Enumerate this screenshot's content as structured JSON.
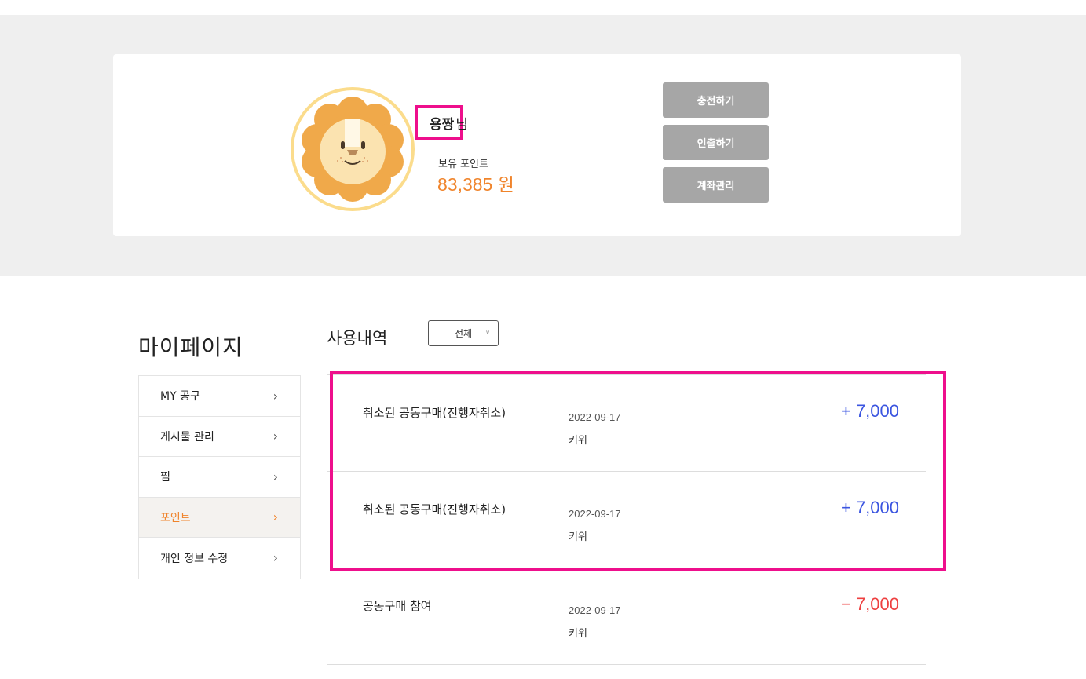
{
  "profile": {
    "user_name": "용짱",
    "honorific": "님",
    "points_label": "보유 포인트",
    "points_value": "83,385 원",
    "buttons": [
      "충전하기",
      "인출하기",
      "계좌관리"
    ]
  },
  "sidebar": {
    "title": "마이페이지",
    "items": [
      {
        "label": "MY 공구",
        "active": false
      },
      {
        "label": "게시물 관리",
        "active": false
      },
      {
        "label": "찜",
        "active": false
      },
      {
        "label": "포인트",
        "active": true
      },
      {
        "label": "개인 정보 수정",
        "active": false
      }
    ]
  },
  "history": {
    "title": "사용내역",
    "filter": "전체",
    "rows": [
      {
        "desc": "취소된 공동구매(진행자취소)",
        "date": "2022-09-17",
        "sub": "키위",
        "amount": "+ 7,000",
        "type": "plus"
      },
      {
        "desc": "취소된 공동구매(진행자취소)",
        "date": "2022-09-17",
        "sub": "키위",
        "amount": "+ 7,000",
        "type": "plus"
      },
      {
        "desc": "공동구매 참여",
        "date": "2022-09-17",
        "sub": "키위",
        "amount": "− 7,000",
        "type": "minus"
      }
    ]
  },
  "colors": {
    "accent": "#f0842b",
    "plus": "#3b55e0",
    "minus": "#ee4040",
    "highlight": "#ee0f8c",
    "button_bg": "#a6a6a6"
  },
  "icons": {
    "avatar": "lion-avatar-icon",
    "menu_chevron": "chevron-right-icon",
    "filter_chevron": "chevron-down-icon"
  }
}
